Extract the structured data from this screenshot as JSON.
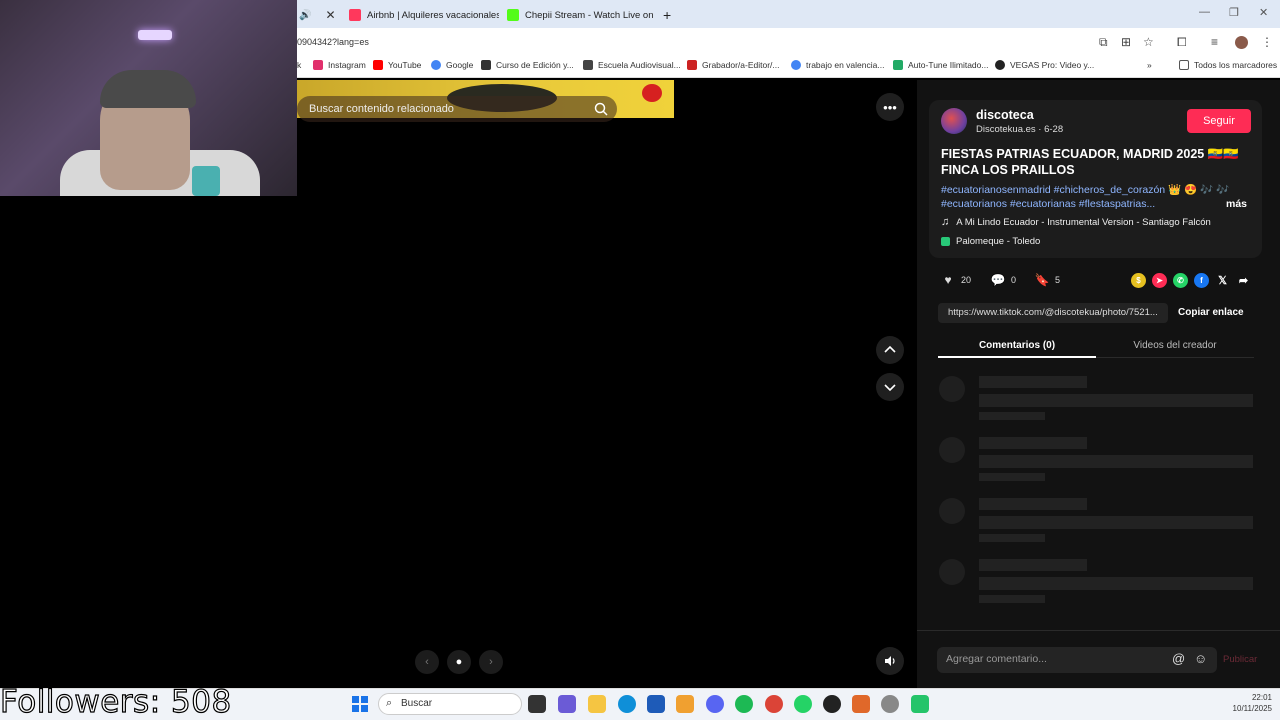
{
  "browser": {
    "tabs": [
      {
        "label": "Airbnb | Alquileres vacacionales",
        "icon": "airbnb-icon",
        "color": "#ff385c"
      },
      {
        "label": "Chepii Stream - Watch Live on",
        "icon": "kick-icon",
        "color": "#53fc18"
      }
    ],
    "url": "0904342?lang=es",
    "bookmarks": [
      {
        "label": "Instagram",
        "color": "#e1306c"
      },
      {
        "label": "YouTube",
        "color": "#ff0000"
      },
      {
        "label": "Google",
        "color": "#4285f4"
      },
      {
        "label": "Curso de Edición y...",
        "color": "#333333"
      },
      {
        "label": "Escuela Audiovisual...",
        "color": "#444444"
      },
      {
        "label": "Grabador/a-Editor/...",
        "color": "#cc2222"
      },
      {
        "label": "trabajo en valencia...",
        "color": "#4285f4"
      },
      {
        "label": "Auto-Tune Ilimitado...",
        "color": "#22aa66"
      },
      {
        "label": "VEGAS Pro: Video y...",
        "color": "#222222"
      }
    ],
    "all_bookmarks": "Todos los marcadores"
  },
  "media": {
    "search_placeholder": "Buscar contenido relacionado"
  },
  "creator": {
    "name": "discoteca",
    "sub": "Discotekua.es · 6-28",
    "follow_label": "Seguir"
  },
  "post": {
    "title": "FIESTAS PATRIAS ECUADOR, MADRID 2025 🇪🇨🇪🇨 FINCA LOS PRAILLOS",
    "hashtags": "#ecuatorianosenmadrid #chicheros_de_corazón 👑 😍 🎶 🎶 #ecuatorianos #ecuatorianas #flestaspatrias...",
    "more_label": "más",
    "music": "A Mi Lindo Ecuador - Instrumental Version - Santiago Falcón",
    "location": "Palomeque - Toledo"
  },
  "stats": {
    "likes": "20",
    "comments": "0",
    "saves": "5"
  },
  "share": {
    "link": "https://www.tiktok.com/@discotekua/photo/7521...",
    "copy_label": "Copiar enlace"
  },
  "panel_tabs": {
    "comments": "Comentarios (0)",
    "creator_videos": "Videos del creador"
  },
  "comment_box": {
    "placeholder": "Agregar comentario...",
    "publish_label": "Publicar"
  },
  "overlay": {
    "followers": "Followers: 508"
  },
  "taskbar": {
    "search_label": "Buscar",
    "time": "22:01",
    "date": "10/11/2025"
  },
  "colors": {
    "accent": "#fe2c55",
    "panel_bg": "#121212",
    "hashtag": "#8fb6ff"
  }
}
